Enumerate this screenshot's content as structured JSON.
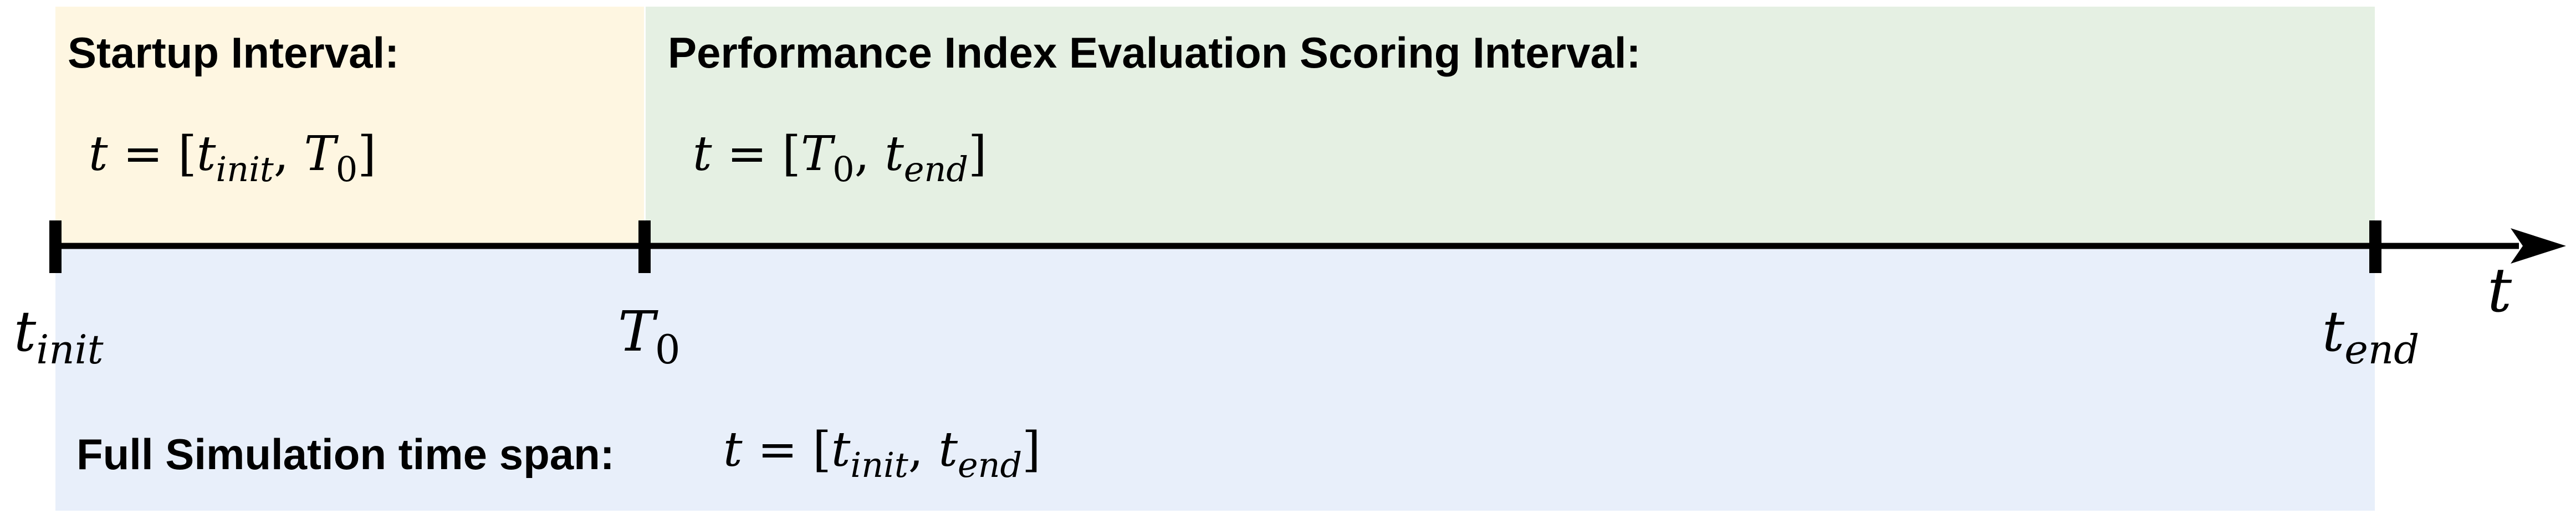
{
  "colors": {
    "startup_fill": "#fef6e1",
    "scoring_fill": "#e5f0e3",
    "full_fill": "#e8effa",
    "axis": "#000000"
  },
  "startup": {
    "label": "Startup Interval:",
    "interval": {
      "var": "t",
      "eq": " = [",
      "a": "t",
      "a_sub": "init",
      "sep": ", ",
      "b": "T",
      "b_sub": "0",
      "close": "]"
    }
  },
  "scoring": {
    "label": "Performance Index Evaluation Scoring Interval:",
    "interval": {
      "var": "t",
      "eq": " = [",
      "a": "T",
      "a_sub": "0",
      "sep": ", ",
      "b": "t",
      "b_sub": "end",
      "close": "]"
    }
  },
  "full": {
    "label": "Full Simulation time span:",
    "interval": {
      "var": "t",
      "eq": " = [",
      "a": "t",
      "a_sub": "init",
      "sep": ", ",
      "b": "t",
      "b_sub": "end",
      "close": "]"
    }
  },
  "ticks": [
    {
      "base": "t",
      "sub": "init"
    },
    {
      "base": "T",
      "sub": "0"
    },
    {
      "base": "t",
      "sub": "end"
    }
  ],
  "axis_label": "t"
}
